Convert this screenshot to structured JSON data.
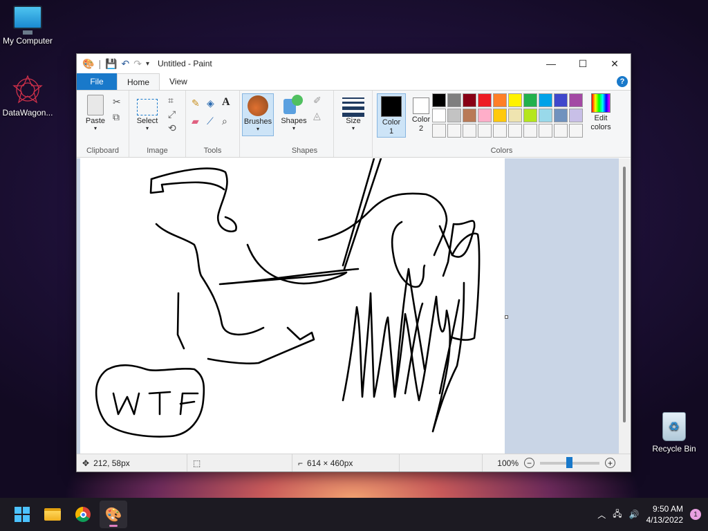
{
  "desktop": {
    "icons": [
      {
        "label": "My Computer"
      },
      {
        "label": "DataWagon..."
      },
      {
        "label": "Recycle Bin"
      }
    ]
  },
  "window": {
    "title": "Untitled - Paint"
  },
  "ribbon": {
    "tabs": {
      "file": "File",
      "home": "Home",
      "view": "View"
    },
    "groups": {
      "clipboard": "Clipboard",
      "image": "Image",
      "tools": "Tools",
      "shapes": "Shapes",
      "colors": "Colors"
    },
    "buttons": {
      "paste": "Paste",
      "select": "Select",
      "brushes": "Brushes",
      "shapes": "Shapes",
      "size": "Size",
      "color1": "Color 1",
      "color2": "Color 2",
      "edit_colors": "Edit colors"
    },
    "palette_row1": [
      "#000000",
      "#7f7f7f",
      "#880015",
      "#ed1c24",
      "#ff7f27",
      "#fff200",
      "#22b14c",
      "#00a2e8",
      "#3f48cc",
      "#a349a4"
    ],
    "palette_row2": [
      "#ffffff",
      "#c3c3c3",
      "#b97a57",
      "#ffaec9",
      "#ffc90e",
      "#efe4b0",
      "#b5e61d",
      "#99d9ea",
      "#7092be",
      "#c8bfe7"
    ],
    "palette_row3": [
      "#f5f5f5",
      "#f5f5f5",
      "#f5f5f5",
      "#f5f5f5",
      "#f5f5f5",
      "#f5f5f5",
      "#f5f5f5",
      "#f5f5f5",
      "#f5f5f5",
      "#f5f5f5"
    ],
    "color1_value": "#000000",
    "color2_value": "#ffffff"
  },
  "statusbar": {
    "cursor_pos": "212, 58px",
    "image_size": "614 × 460px",
    "zoom": "100%"
  },
  "taskbar": {
    "time": "9:50 AM",
    "date": "4/13/2022",
    "notifications": "1"
  }
}
